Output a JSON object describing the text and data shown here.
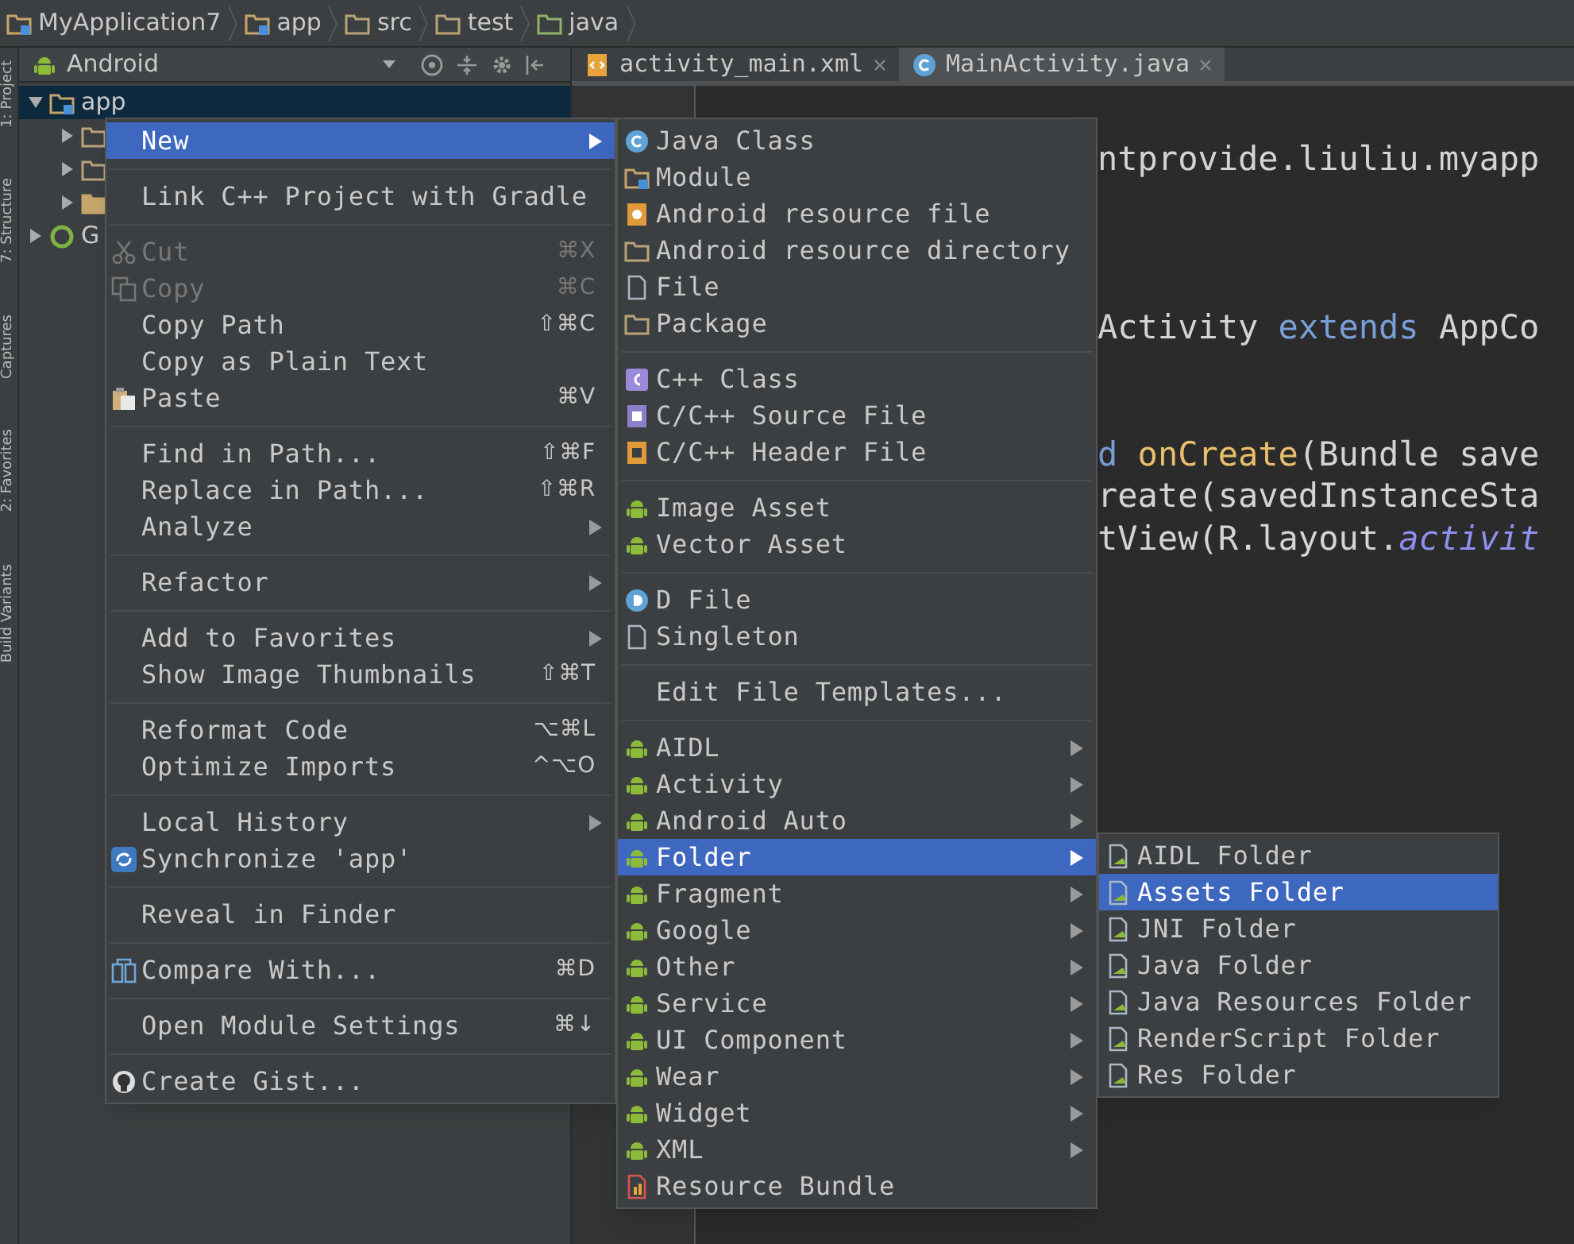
{
  "breadcrumb": [
    {
      "label": "MyApplication7",
      "kind": "module"
    },
    {
      "label": "app",
      "kind": "module"
    },
    {
      "label": "src",
      "kind": "folder"
    },
    {
      "label": "test",
      "kind": "folder"
    },
    {
      "label": "java",
      "kind": "greenfolder"
    }
  ],
  "tool_strip": [
    "1: Project",
    "7: Structure",
    "Captures",
    "2: Favorites",
    "Build Variants"
  ],
  "project_panel": {
    "view": "Android",
    "tree": [
      {
        "label": "app",
        "kind": "module",
        "expanded": true,
        "selected": true,
        "children": [
          {
            "kind": "folder",
            "expanded": false
          },
          {
            "kind": "folder",
            "expanded": false
          },
          {
            "kind": "resfolder",
            "expanded": false
          }
        ]
      },
      {
        "label": "G",
        "kind": "gradle",
        "expanded": false,
        "selected": false
      }
    ]
  },
  "editor_tabs": [
    {
      "label": "activity_main.xml",
      "kind": "xml",
      "selected": false
    },
    {
      "label": "MainActivity.java",
      "kind": "javaclass",
      "selected": true
    }
  ],
  "code_lines": [
    [
      {
        "text": "ntprovide.liuliu.myapp",
        "kind": "plain"
      }
    ],
    [
      {
        "text": "Activity ",
        "kind": "plain"
      },
      {
        "text": "extends",
        "kind": "keyword"
      },
      {
        "text": " AppCo",
        "kind": "plain"
      }
    ],
    [
      {
        "text": "d",
        "kind": "keyword"
      },
      {
        "text": " onCreate",
        "kind": "method"
      },
      {
        "text": "(Bundle save",
        "kind": "plain"
      }
    ],
    [
      {
        "text": "reate(savedInstanceSta",
        "kind": "plain"
      }
    ],
    [
      {
        "text": "tView(R.layout.",
        "kind": "plain"
      },
      {
        "text": "activit",
        "kind": "field"
      }
    ]
  ],
  "context_menu": [
    {
      "kind": "plain",
      "label": "New",
      "submenu": true,
      "selected": true,
      "disabled": false
    },
    {
      "kind": "separator"
    },
    {
      "kind": "plain",
      "label": "Link C++ Project with Gradle",
      "submenu": false,
      "selected": false,
      "disabled": false
    },
    {
      "kind": "separator"
    },
    {
      "kind": "cut",
      "label": "Cut",
      "shortcut": "⌘X",
      "submenu": false,
      "selected": false,
      "disabled": true
    },
    {
      "kind": "copy",
      "label": "Copy",
      "shortcut": "⌘C",
      "submenu": false,
      "selected": false,
      "disabled": true
    },
    {
      "kind": "plain",
      "label": "Copy Path",
      "shortcut": "⇧⌘C",
      "submenu": false,
      "selected": false,
      "disabled": false
    },
    {
      "kind": "plain",
      "label": "Copy as Plain Text",
      "submenu": false,
      "selected": false,
      "disabled": false
    },
    {
      "kind": "paste",
      "label": "Paste",
      "shortcut": "⌘V",
      "submenu": false,
      "selected": false,
      "disabled": false
    },
    {
      "kind": "separator"
    },
    {
      "kind": "plain",
      "label": "Find in Path...",
      "shortcut": "⇧⌘F",
      "submenu": false,
      "selected": false,
      "disabled": false
    },
    {
      "kind": "plain",
      "label": "Replace in Path...",
      "shortcut": "⇧⌘R",
      "submenu": false,
      "selected": false,
      "disabled": false
    },
    {
      "kind": "plain",
      "label": "Analyze",
      "submenu": true,
      "selected": false,
      "disabled": false
    },
    {
      "kind": "separator"
    },
    {
      "kind": "plain",
      "label": "Refactor",
      "submenu": true,
      "selected": false,
      "disabled": false
    },
    {
      "kind": "separator"
    },
    {
      "kind": "plain",
      "label": "Add to Favorites",
      "submenu": true,
      "selected": false,
      "disabled": false
    },
    {
      "kind": "plain",
      "label": "Show Image Thumbnails",
      "shortcut": "⇧⌘T",
      "submenu": false,
      "selected": false,
      "disabled": false
    },
    {
      "kind": "separator"
    },
    {
      "kind": "plain",
      "label": "Reformat Code",
      "shortcut": "⌥⌘L",
      "submenu": false,
      "selected": false,
      "disabled": false
    },
    {
      "kind": "plain",
      "label": "Optimize Imports",
      "shortcut": "^⌥O",
      "submenu": false,
      "selected": false,
      "disabled": false
    },
    {
      "kind": "separator"
    },
    {
      "kind": "plain",
      "label": "Local History",
      "submenu": true,
      "selected": false,
      "disabled": false
    },
    {
      "kind": "sync",
      "label": "Synchronize 'app'",
      "submenu": false,
      "selected": false,
      "disabled": false
    },
    {
      "kind": "separator"
    },
    {
      "kind": "plain",
      "label": "Reveal in Finder",
      "submenu": false,
      "selected": false,
      "disabled": false
    },
    {
      "kind": "separator"
    },
    {
      "kind": "compare",
      "label": "Compare With...",
      "shortcut": "⌘D",
      "submenu": false,
      "selected": false,
      "disabled": false
    },
    {
      "kind": "separator"
    },
    {
      "kind": "plain",
      "label": "Open Module Settings",
      "shortcut": "⌘↓",
      "submenu": false,
      "selected": false,
      "disabled": false
    },
    {
      "kind": "separator"
    },
    {
      "kind": "gist",
      "label": "Create Gist...",
      "submenu": false,
      "selected": false,
      "disabled": false
    }
  ],
  "new_submenu": [
    {
      "kind": "javaclass",
      "label": "Java Class",
      "submenu": false,
      "selected": false
    },
    {
      "kind": "module",
      "label": "Module",
      "submenu": false,
      "selected": false
    },
    {
      "kind": "resfile",
      "label": "Android resource file",
      "submenu": false,
      "selected": false
    },
    {
      "kind": "folder",
      "label": "Android resource directory",
      "submenu": false,
      "selected": false
    },
    {
      "kind": "file",
      "label": "File",
      "submenu": false,
      "selected": false
    },
    {
      "kind": "folder",
      "label": "Package",
      "submenu": false,
      "selected": false
    },
    {
      "kind": "separator"
    },
    {
      "kind": "cppclass",
      "label": "C++ Class",
      "submenu": false,
      "selected": false
    },
    {
      "kind": "cppsource",
      "label": "C/C++ Source File",
      "submenu": false,
      "selected": false
    },
    {
      "kind": "cppheader",
      "label": "C/C++ Header File",
      "submenu": false,
      "selected": false
    },
    {
      "kind": "separator"
    },
    {
      "kind": "android",
      "label": "Image Asset",
      "submenu": false,
      "selected": false
    },
    {
      "kind": "android",
      "label": "Vector Asset",
      "submenu": false,
      "selected": false
    },
    {
      "kind": "separator"
    },
    {
      "kind": "dfile",
      "label": "D File",
      "submenu": false,
      "selected": false
    },
    {
      "kind": "file",
      "label": "Singleton",
      "submenu": false,
      "selected": false
    },
    {
      "kind": "separator"
    },
    {
      "kind": "plain",
      "label": "Edit File Templates...",
      "submenu": false,
      "selected": false
    },
    {
      "kind": "separator"
    },
    {
      "kind": "android",
      "label": "AIDL",
      "submenu": true,
      "selected": false
    },
    {
      "kind": "android",
      "label": "Activity",
      "submenu": true,
      "selected": false
    },
    {
      "kind": "android",
      "label": "Android Auto",
      "submenu": true,
      "selected": false
    },
    {
      "kind": "android",
      "label": "Folder",
      "submenu": true,
      "selected": true
    },
    {
      "kind": "android",
      "label": "Fragment",
      "submenu": true,
      "selected": false
    },
    {
      "kind": "android",
      "label": "Google",
      "submenu": true,
      "selected": false
    },
    {
      "kind": "android",
      "label": "Other",
      "submenu": true,
      "selected": false
    },
    {
      "kind": "android",
      "label": "Service",
      "submenu": true,
      "selected": false
    },
    {
      "kind": "android",
      "label": "UI Component",
      "submenu": true,
      "selected": false
    },
    {
      "kind": "android",
      "label": "Wear",
      "submenu": true,
      "selected": false
    },
    {
      "kind": "android",
      "label": "Widget",
      "submenu": true,
      "selected": false
    },
    {
      "kind": "android",
      "label": "XML",
      "submenu": true,
      "selected": false
    },
    {
      "kind": "bundle",
      "label": "Resource Bundle",
      "submenu": false,
      "selected": false
    }
  ],
  "folder_submenu": [
    {
      "kind": "newfolder",
      "label": "AIDL Folder",
      "selected": false
    },
    {
      "kind": "newfolder",
      "label": "Assets Folder",
      "selected": true
    },
    {
      "kind": "newfolder",
      "label": "JNI Folder",
      "selected": false
    },
    {
      "kind": "newfolder",
      "label": "Java Folder",
      "selected": false
    },
    {
      "kind": "newfolder",
      "label": "Java Resources Folder",
      "selected": false
    },
    {
      "kind": "newfolder",
      "label": "RenderScript Folder",
      "selected": false
    },
    {
      "kind": "newfolder",
      "label": "Res Folder",
      "selected": false
    }
  ]
}
